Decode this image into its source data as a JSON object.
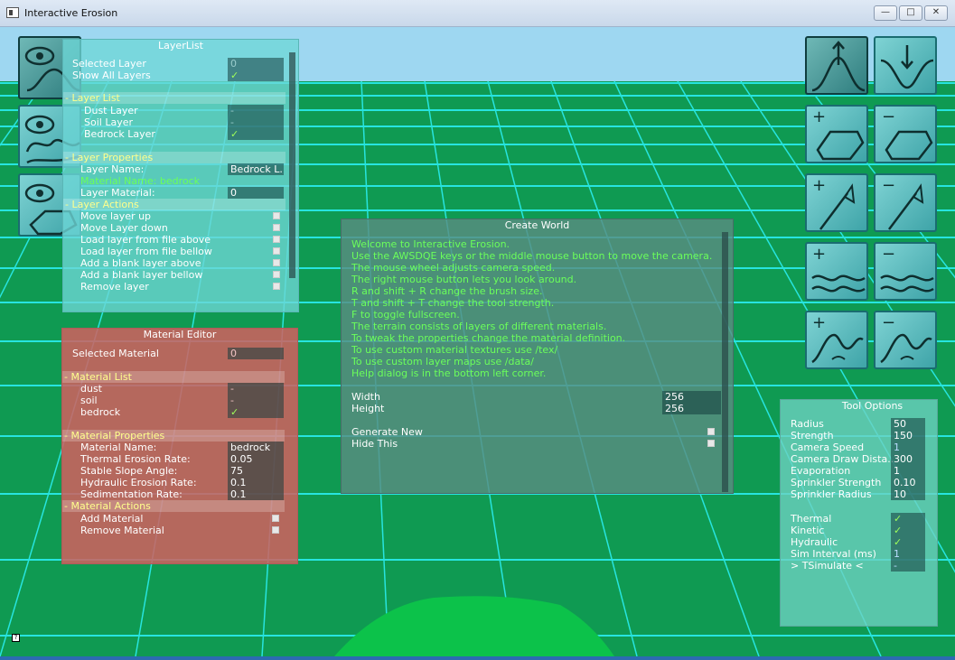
{
  "window": {
    "title": "Interactive Erosion",
    "buttons": [
      "—",
      "□",
      "✕"
    ]
  },
  "colors": {
    "terrain": "#0f9a52",
    "grid": "#27e4df",
    "sky": "#9ed7f1",
    "status_green": "#6bff5a",
    "section_yellow": "#ffff8c"
  },
  "layer_list": {
    "title": "LayerList",
    "selected_layer_label": "Selected Layer",
    "selected_layer_value": "0",
    "show_all_label": "Show All Layers",
    "show_all_value": "✓",
    "section_list": "Layer List",
    "layers": [
      {
        "label": "Dust Layer",
        "value": "-"
      },
      {
        "label": "Soil Layer",
        "value": "-"
      },
      {
        "label": "Bedrock Layer",
        "value": "✓"
      }
    ],
    "section_props": "Layer Properties",
    "layer_name_label": "Layer Name:",
    "layer_name_value": "Bedrock L...",
    "material_name_text": "Material Name: bedrock",
    "layer_material_label": "Layer Material:",
    "layer_material_value": "0",
    "section_actions": "Layer Actions",
    "actions": [
      "Move layer up",
      "Move Layer down",
      "Load layer from file above",
      "Load layer from file bellow",
      "Add a blank layer above",
      "Add a blank layer bellow",
      "Remove layer"
    ]
  },
  "material_editor": {
    "title": "Material Editor",
    "selected_label": "Selected Material",
    "selected_value": "0",
    "section_list": "Material List",
    "materials": [
      {
        "label": "dust",
        "value": "-"
      },
      {
        "label": "soil",
        "value": "-"
      },
      {
        "label": "bedrock",
        "value": "✓"
      }
    ],
    "section_props": "Material Properties",
    "props": [
      {
        "label": "Material Name:",
        "value": "bedrock"
      },
      {
        "label": "Thermal Erosion Rate:",
        "value": "0.05"
      },
      {
        "label": "Stable Slope Angle:",
        "value": "75"
      },
      {
        "label": "Hydraulic Erosion Rate:",
        "value": "0.1"
      },
      {
        "label": "Sedimentation Rate:",
        "value": "0.1"
      }
    ],
    "section_actions": "Material Actions",
    "actions": [
      "Add Material",
      "Remove Material"
    ]
  },
  "create_world": {
    "title": "Create World",
    "lines": [
      "Welcome to Interactive Erosion.",
      "Use the AWSDQE keys or the middle mouse button to move the camera.",
      "The mouse wheel adjusts camera speed.",
      "The right mouse button lets you look around.",
      "R and shift + R change the brush size.",
      "T and shift + T change the tool strength.",
      "F to toggle fullscreen.",
      "The terrain consists of layers of different materials.",
      "To tweak the properties change the material definition.",
      "To use custom material textures use /tex/",
      "To use custom layer maps use /data/",
      "Help dialog is in the bottom left corner."
    ],
    "width_label": "Width",
    "width_value": "256",
    "height_label": "Height",
    "height_value": "256",
    "generate_label": "Generate New",
    "hide_label": "Hide This"
  },
  "tool_options": {
    "title": "Tool Options",
    "rows": [
      {
        "label": "Radius",
        "value": "50"
      },
      {
        "label": "Strength",
        "value": "150"
      },
      {
        "label": "Camera Speed",
        "value": "1"
      },
      {
        "label": "Camera Draw Dista..",
        "value": "300"
      },
      {
        "label": "Evaporation",
        "value": "1"
      },
      {
        "label": "Sprinkler Strength",
        "value": "0.10"
      },
      {
        "label": "Sprinkler Radius",
        "value": "10"
      }
    ],
    "rows2": [
      {
        "label": "Thermal",
        "value": "✓"
      },
      {
        "label": "Kinetic",
        "value": "✓"
      },
      {
        "label": "Hydraulic",
        "value": "✓"
      },
      {
        "label": "Sim Interval (ms)",
        "value": "1"
      },
      {
        "label": "> TSimulate <",
        "value": "-"
      }
    ]
  },
  "left_tools": [
    "view-layer-surface-icon",
    "view-layer-soil-icon",
    "view-layer-bedrock-icon"
  ],
  "right_tools": [
    "raise-terrain-icon",
    "lower-terrain-icon",
    "add-hexagon-icon",
    "remove-hexagon-icon",
    "add-sprinkler-icon",
    "remove-sprinkler-icon",
    "add-water-icon",
    "remove-water-icon",
    "add-mound-icon",
    "remove-mound-icon"
  ]
}
